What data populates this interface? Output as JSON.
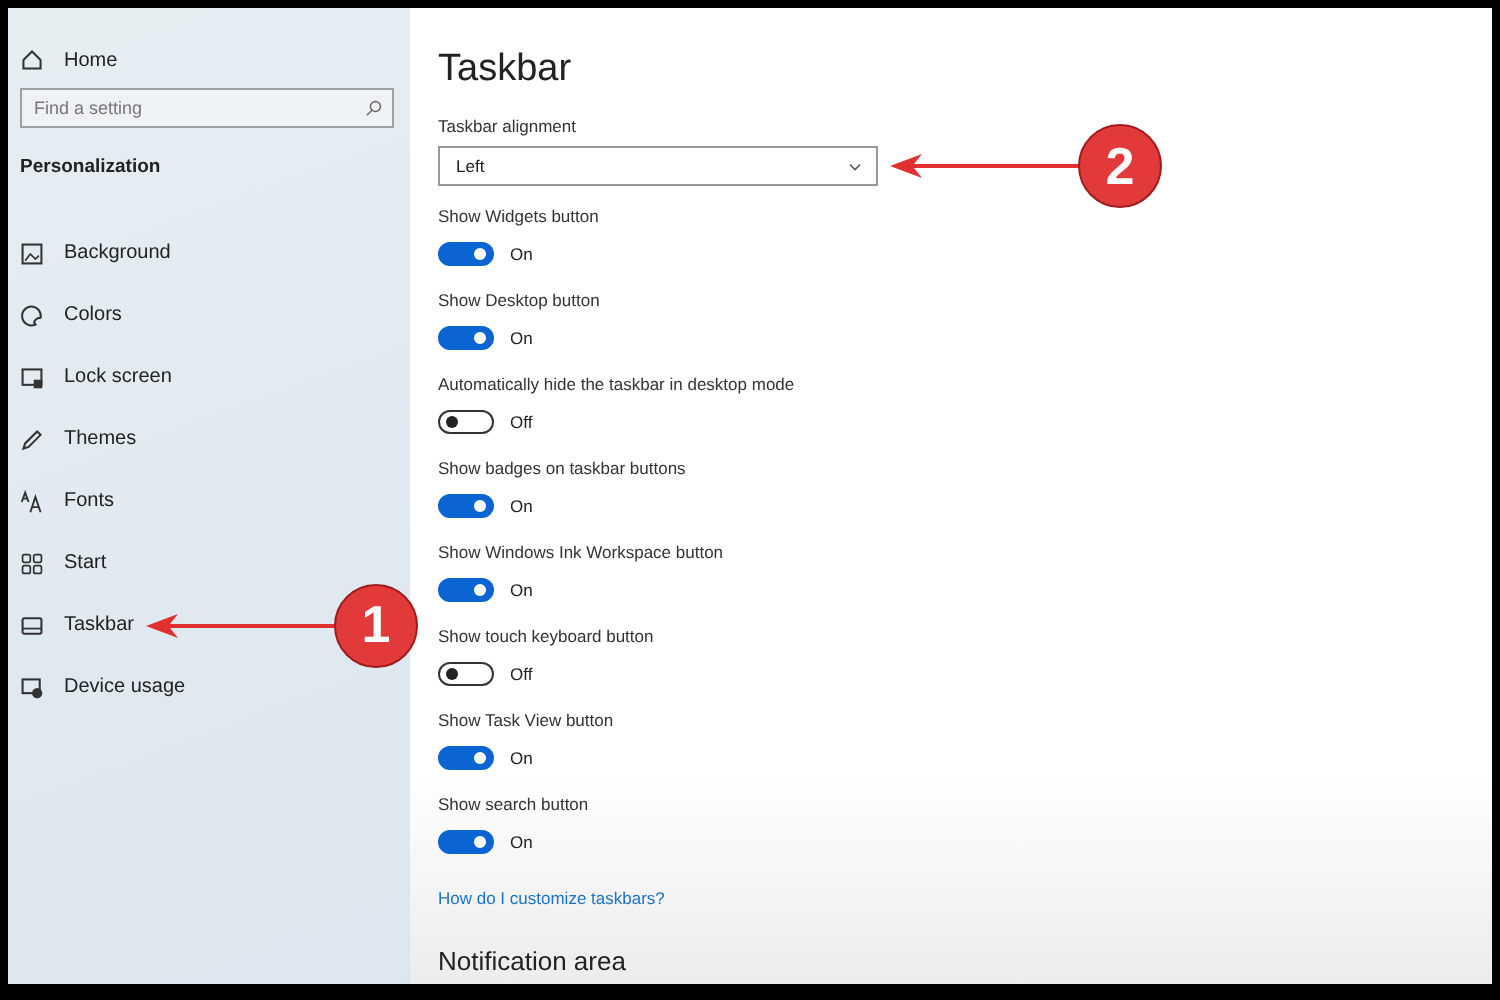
{
  "sidebar": {
    "home": "Home",
    "search": {
      "placeholder": "Find a setting"
    },
    "section": "Personalization",
    "items": [
      {
        "label": "Background"
      },
      {
        "label": "Colors"
      },
      {
        "label": "Lock screen"
      },
      {
        "label": "Themes"
      },
      {
        "label": "Fonts"
      },
      {
        "label": "Start"
      },
      {
        "label": "Taskbar"
      },
      {
        "label": "Device usage"
      }
    ]
  },
  "main": {
    "title": "Taskbar",
    "alignment": {
      "label": "Taskbar alignment",
      "value": "Left"
    },
    "settings": [
      {
        "label": "Show Widgets button",
        "on": true,
        "state": "On"
      },
      {
        "label": "Show Desktop button",
        "on": true,
        "state": "On"
      },
      {
        "label": "Automatically hide the taskbar in desktop mode",
        "on": false,
        "state": "Off"
      },
      {
        "label": "Show badges on taskbar buttons",
        "on": true,
        "state": "On"
      },
      {
        "label": "Show Windows Ink Workspace button",
        "on": true,
        "state": "On"
      },
      {
        "label": "Show touch keyboard button",
        "on": false,
        "state": "Off"
      },
      {
        "label": "Show Task View button",
        "on": true,
        "state": "On"
      },
      {
        "label": "Show search button",
        "on": true,
        "state": "On"
      }
    ],
    "link": "How do I customize taskbars?",
    "next_section": "Notification area"
  },
  "callouts": [
    {
      "number": "1"
    },
    {
      "number": "2"
    }
  ]
}
